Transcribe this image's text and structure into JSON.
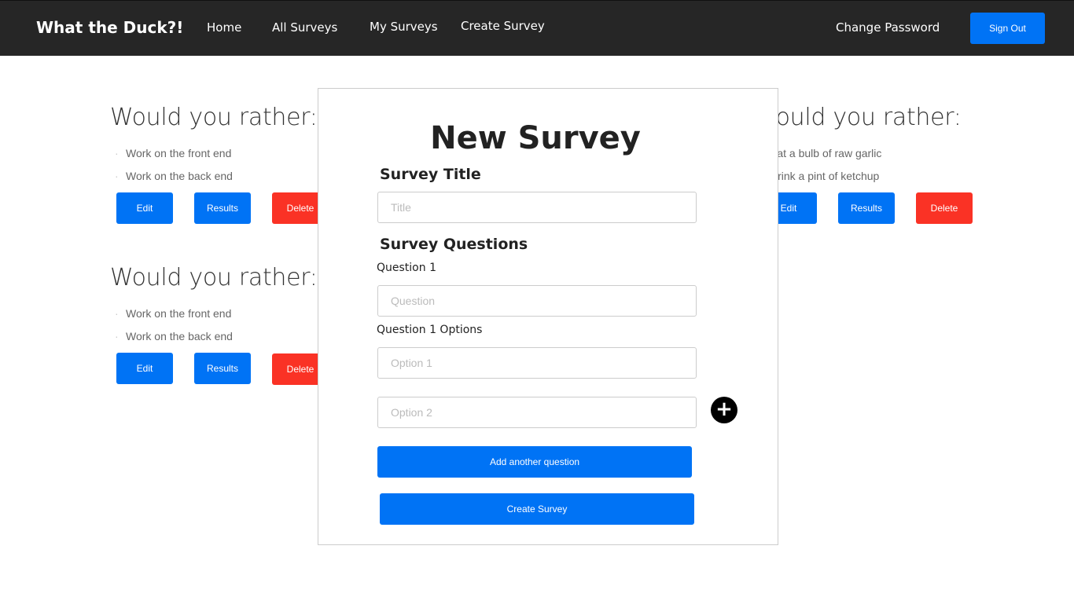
{
  "nav": {
    "brand": "What the Duck?!",
    "links": [
      "Home",
      "All Surveys",
      "My Surveys",
      "Create Survey"
    ],
    "change_password": "Change Password",
    "sign_out": "Sign Out"
  },
  "cards": [
    {
      "heading": "Would you rather:",
      "options": [
        "Work on the front end",
        "Work on the back end"
      ]
    },
    {
      "heading": "Would you rather:",
      "options": [
        "Eat a bulb of raw garlic",
        "Drink a pint of ketchup"
      ]
    },
    {
      "heading": "Would you rather:",
      "options": [
        "Work on the front end",
        "Work on the back end"
      ]
    }
  ],
  "card_buttons": {
    "edit": "Edit",
    "results": "Results",
    "delete": "Delete"
  },
  "modal": {
    "title": "New Survey",
    "survey_title_label": "Survey Title",
    "title_placeholder": "Title",
    "questions_label": "Survey Questions",
    "question_label": "Question 1",
    "question_placeholder": "Question",
    "options_label": "Question 1 Options",
    "option1_placeholder": "Option 1",
    "option2_placeholder": "Option 2",
    "add_question": "Add another question",
    "create": "Create Survey",
    "add_option_icon": "plus-circle-icon"
  },
  "colors": {
    "primary": "#0073f5",
    "danger": "#fa3225",
    "navbar": "#262626"
  }
}
